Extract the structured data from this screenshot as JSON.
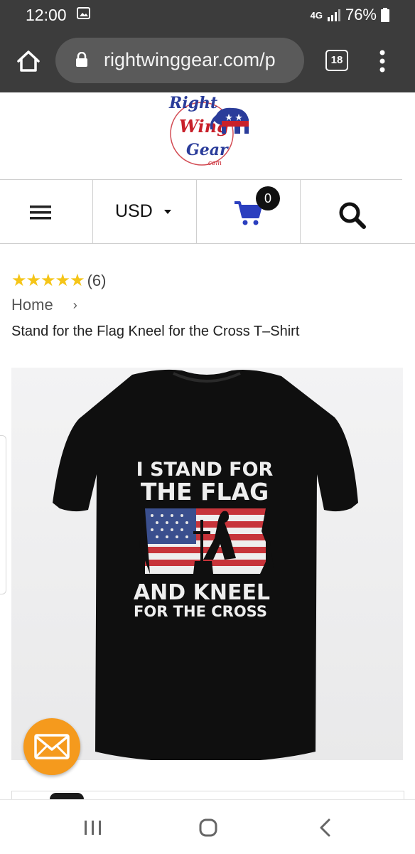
{
  "status_bar": {
    "time": "12:00",
    "network": "4G",
    "battery": "76%"
  },
  "browser": {
    "url": "rightwinggear.com/p",
    "tab_count": "18"
  },
  "logo": {
    "line1": "Right",
    "line2": "Wing",
    "line3": "Gear",
    "suffix": ".com"
  },
  "nav": {
    "currency": "USD",
    "cart_count": "0"
  },
  "product": {
    "stars": "★★★★★",
    "rating": 5,
    "review_count": "(6)",
    "breadcrumb_home": "Home",
    "breadcrumb_sep": "›",
    "title": "Stand for the Flag Kneel for the Cross T–Shirt",
    "shirt_text": {
      "line1": "I STAND FOR",
      "line2": "THE FLAG",
      "line3": "AND KNEEL",
      "line4": "FOR THE CROSS"
    }
  },
  "colors": {
    "browser_chrome": "#3c3c3c",
    "url_box": "#5a5a5a",
    "cart_blue": "#2b3fbf",
    "star_gold": "#f5c518",
    "chat_orange": "#f59a1d",
    "logo_red": "#c8202a",
    "logo_blue": "#2a3c9a"
  }
}
